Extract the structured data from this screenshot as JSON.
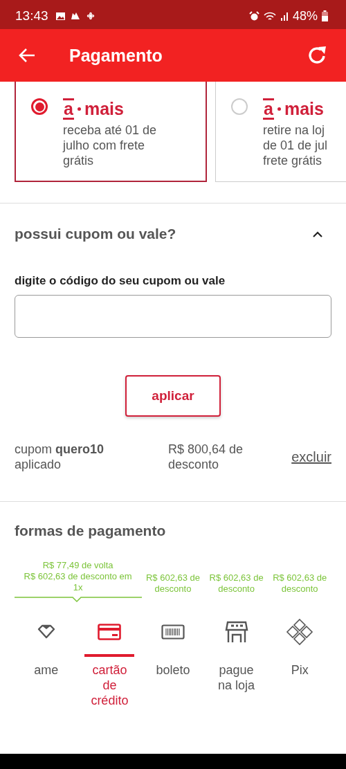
{
  "status_bar": {
    "time": "13:43",
    "battery": "48%"
  },
  "header": {
    "title": "Pagamento"
  },
  "delivery_options": [
    {
      "selected": true,
      "brand_mark": "a",
      "brand_name": "mais",
      "lines": [
        "receba até 01 de",
        "julho com frete",
        "grátis"
      ]
    },
    {
      "selected": false,
      "brand_mark": "a",
      "brand_name": "mais",
      "lines": [
        "retire na loj",
        "de 01 de jul",
        "frete grátis"
      ]
    }
  ],
  "coupon": {
    "title": "possui cupom ou vale?",
    "expanded": true,
    "field_label": "digite o código do seu cupom ou vale",
    "apply_button": "aplicar",
    "applied": "cupom **quero10** aplicado",
    "discount": "R$ 800,64 de desconto",
    "remove_link": "excluir"
  },
  "payment": {
    "title": "formas de pagamento",
    "offers": [
      {
        "kind": "group",
        "lines": [
          "R$ 77,49 de volta",
          "R$ 602,63 de desconto em 1x"
        ]
      },
      {
        "kind": "single",
        "lines": [
          "R$ 602,63 de",
          "desconto"
        ]
      },
      {
        "kind": "single",
        "lines": [
          "R$ 602,63 de",
          "desconto"
        ]
      },
      {
        "kind": "single",
        "lines": [
          "R$ 602,63 de",
          "desconto"
        ]
      }
    ],
    "methods": [
      {
        "label": "ame",
        "selected": false
      },
      {
        "label": "cartão de crédito",
        "selected": true
      },
      {
        "label": "boleto",
        "selected": false
      },
      {
        "label": "pague na loja",
        "selected": false
      },
      {
        "label": "Pix",
        "selected": false
      }
    ]
  }
}
